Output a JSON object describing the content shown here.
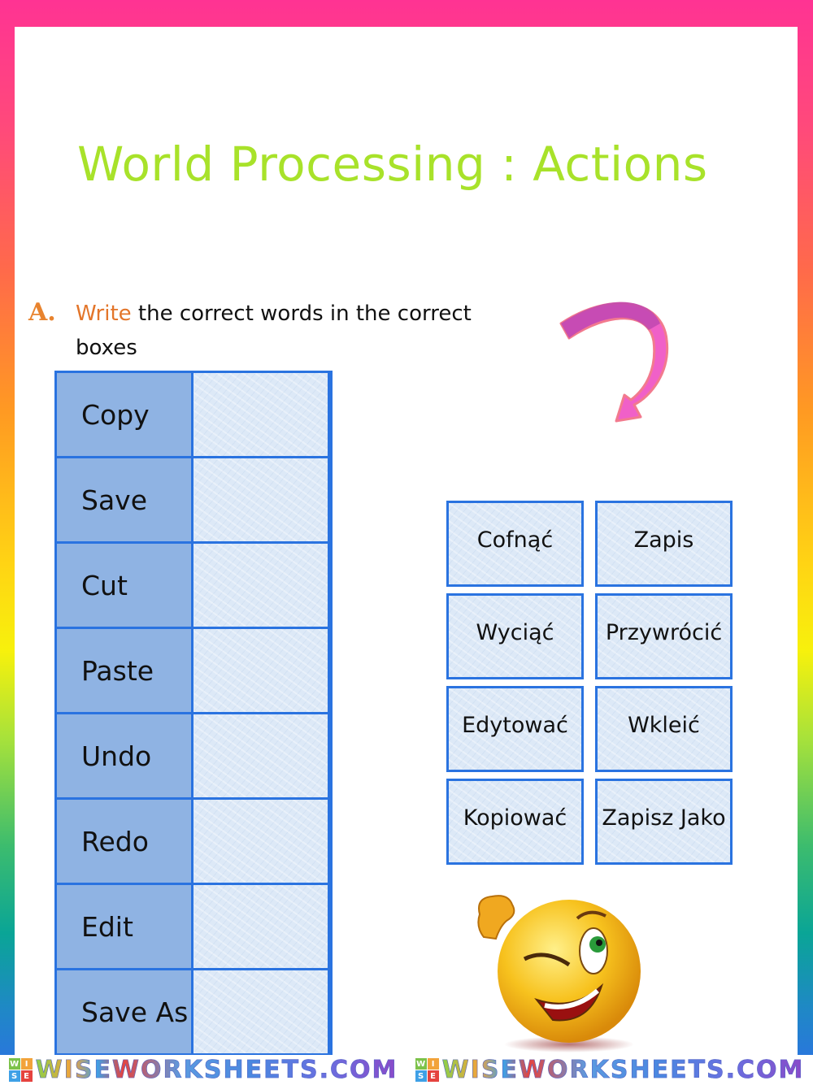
{
  "title": "World Processing : Actions",
  "instruction": {
    "letter": "A.",
    "verb": "Write",
    "rest": "the correct words in the correct",
    "line2": "boxes"
  },
  "table": {
    "rows": [
      {
        "label": "Copy",
        "answer": ""
      },
      {
        "label": "Save",
        "answer": ""
      },
      {
        "label": "Cut",
        "answer": ""
      },
      {
        "label": "Paste",
        "answer": ""
      },
      {
        "label": "Undo",
        "answer": ""
      },
      {
        "label": "Redo",
        "answer": ""
      },
      {
        "label": "Edit",
        "answer": ""
      },
      {
        "label": "Save As",
        "answer": ""
      }
    ]
  },
  "word_bank": [
    "Cofnąć",
    "Zapis",
    "Wyciąć",
    "Przywrócić",
    "Edytować",
    "Wkleić",
    "Kopiować",
    "Zapisz Jako"
  ],
  "footer": {
    "brand": "WISEWORKSHEETS.COM",
    "logo_letters": [
      "W",
      "I",
      "S",
      "E"
    ]
  },
  "colors": {
    "title": "#a8e22a",
    "accent_orange": "#e3752a",
    "table_border": "#2a73e0",
    "label_cell": "#8fb3e3",
    "answer_cell": "#dde9f7",
    "arrow": "#f060c8"
  }
}
